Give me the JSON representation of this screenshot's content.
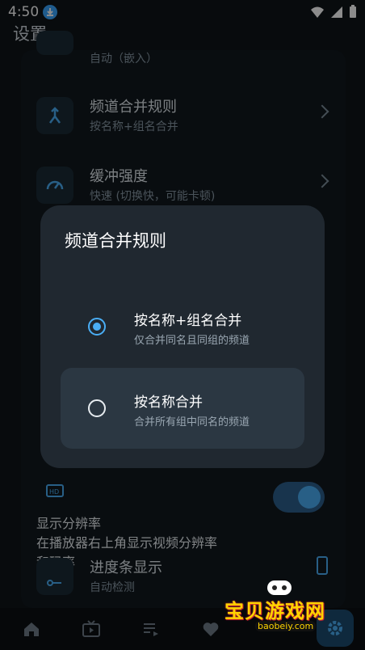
{
  "status_bar": {
    "time": "4:50"
  },
  "page_title": "设置",
  "settings": [
    {
      "title": "",
      "subtitle": "自动（嵌入）",
      "icon": "display-icon"
    },
    {
      "title": "频道合并规则",
      "subtitle": "按名称+组名合并",
      "icon": "merge-icon"
    },
    {
      "title": "缓冲强度",
      "subtitle": "快速 (切换快，可能卡顿)",
      "icon": "speedometer-icon"
    }
  ],
  "dialog": {
    "title": "频道合并规则",
    "options": [
      {
        "title": "按名称+组名合并",
        "subtitle": "仅合并同名且同组的频道",
        "selected": true
      },
      {
        "title": "按名称合并",
        "subtitle": "合并所有组中同名的频道",
        "selected": false
      }
    ]
  },
  "resolution_setting": {
    "title": "显示分辨率",
    "subtitle_line1": "在播放器右上角显示视频分辨率",
    "subtitle_line2": "和码率",
    "enabled": true
  },
  "progress_setting": {
    "title": "进度条显示",
    "subtitle": "自动检测"
  },
  "bottom_nav": [
    "home-icon",
    "tv-icon",
    "playlist-icon",
    "favorite-icon",
    "settings-icon"
  ],
  "watermark": {
    "text": "宝贝游戏网",
    "url": "baobeiy.com"
  },
  "colors": {
    "accent": "#4aaef5",
    "background": "#0f1419",
    "dialog": "#202830"
  }
}
